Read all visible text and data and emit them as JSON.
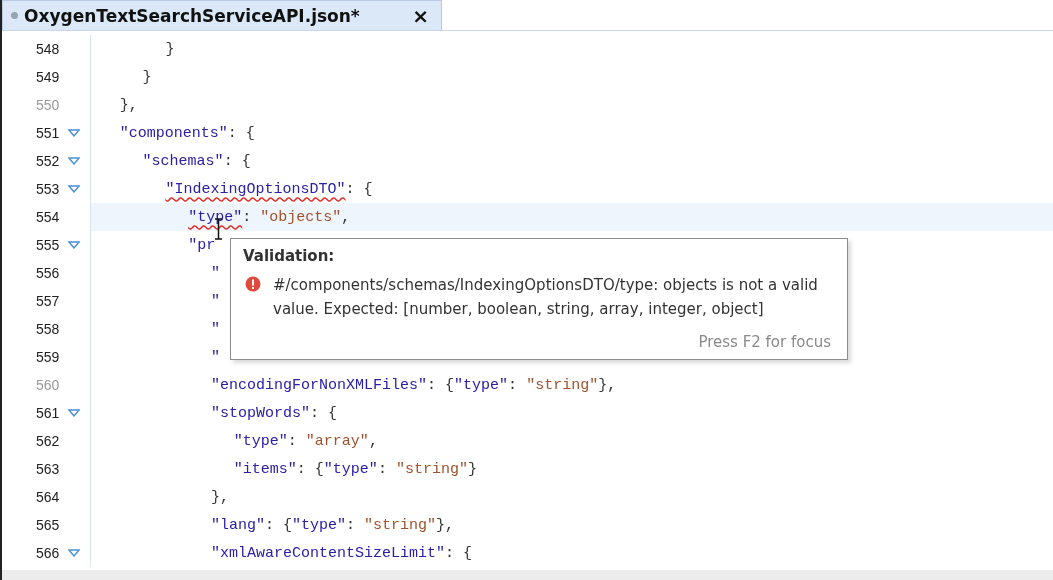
{
  "tab": {
    "title": "OxygenTextSearchServiceAPI.json*",
    "modified": true,
    "close": "×"
  },
  "lines": [
    {
      "number": "548",
      "muted": false,
      "foldable": false,
      "current": false,
      "tokens": [
        {
          "kind": "punct",
          "text": "      }",
          "error": false
        }
      ]
    },
    {
      "number": "549",
      "muted": false,
      "foldable": false,
      "current": false,
      "tokens": [
        {
          "kind": "punct",
          "text": "    }",
          "error": false
        }
      ]
    },
    {
      "number": "550",
      "muted": true,
      "foldable": false,
      "current": false,
      "tokens": [
        {
          "kind": "punct",
          "text": "  },",
          "error": false
        }
      ]
    },
    {
      "number": "551",
      "muted": false,
      "foldable": true,
      "current": false,
      "tokens": [
        {
          "kind": "key",
          "text": "  \"components\"",
          "error": false
        },
        {
          "kind": "punct",
          "text": ": {",
          "error": false
        }
      ]
    },
    {
      "number": "552",
      "muted": false,
      "foldable": true,
      "current": false,
      "tokens": [
        {
          "kind": "key",
          "text": "    \"schemas\"",
          "error": false
        },
        {
          "kind": "punct",
          "text": ": {",
          "error": false
        }
      ]
    },
    {
      "number": "553",
      "muted": false,
      "foldable": true,
      "current": false,
      "tokens": [
        {
          "kind": "key",
          "text": "      \"IndexingOptionsDTO\"",
          "error": true
        },
        {
          "kind": "punct",
          "text": ": {",
          "error": false
        }
      ]
    },
    {
      "number": "554",
      "muted": false,
      "foldable": false,
      "current": true,
      "tokens": [
        {
          "kind": "key",
          "text": "        \"type\"",
          "error": true
        },
        {
          "kind": "punct",
          "text": ": ",
          "error": false
        },
        {
          "kind": "string",
          "text": "\"objects\"",
          "error": false
        },
        {
          "kind": "punct",
          "text": ",",
          "error": false
        }
      ]
    },
    {
      "number": "555",
      "muted": false,
      "foldable": true,
      "current": false,
      "tokens": [
        {
          "kind": "key",
          "text": "        \"pr",
          "error": false
        }
      ]
    },
    {
      "number": "556",
      "muted": false,
      "foldable": false,
      "current": false,
      "tokens": [
        {
          "kind": "key",
          "text": "          \"",
          "error": false
        }
      ]
    },
    {
      "number": "557",
      "muted": false,
      "foldable": false,
      "current": false,
      "tokens": [
        {
          "kind": "key",
          "text": "          \"",
          "error": false
        }
      ]
    },
    {
      "number": "558",
      "muted": false,
      "foldable": false,
      "current": false,
      "tokens": [
        {
          "kind": "key",
          "text": "          \"",
          "error": false
        }
      ]
    },
    {
      "number": "559",
      "muted": false,
      "foldable": false,
      "current": false,
      "tokens": [
        {
          "kind": "key",
          "text": "          \"",
          "error": false
        }
      ]
    },
    {
      "number": "560",
      "muted": true,
      "foldable": false,
      "current": false,
      "tokens": [
        {
          "kind": "key",
          "text": "          \"encodingForNonXMLFiles\"",
          "error": false
        },
        {
          "kind": "punct",
          "text": ": {",
          "error": false
        },
        {
          "kind": "key",
          "text": "\"type\"",
          "error": false
        },
        {
          "kind": "punct",
          "text": ": ",
          "error": false
        },
        {
          "kind": "string",
          "text": "\"string\"",
          "error": false
        },
        {
          "kind": "punct",
          "text": "},",
          "error": false
        }
      ]
    },
    {
      "number": "561",
      "muted": false,
      "foldable": true,
      "current": false,
      "tokens": [
        {
          "kind": "key",
          "text": "          \"stopWords\"",
          "error": false
        },
        {
          "kind": "punct",
          "text": ": {",
          "error": false
        }
      ]
    },
    {
      "number": "562",
      "muted": false,
      "foldable": false,
      "current": false,
      "tokens": [
        {
          "kind": "key",
          "text": "            \"type\"",
          "error": false
        },
        {
          "kind": "punct",
          "text": ": ",
          "error": false
        },
        {
          "kind": "string",
          "text": "\"array\"",
          "error": false
        },
        {
          "kind": "punct",
          "text": ",",
          "error": false
        }
      ]
    },
    {
      "number": "563",
      "muted": false,
      "foldable": false,
      "current": false,
      "tokens": [
        {
          "kind": "key",
          "text": "            \"items\"",
          "error": false
        },
        {
          "kind": "punct",
          "text": ": {",
          "error": false
        },
        {
          "kind": "key",
          "text": "\"type\"",
          "error": false
        },
        {
          "kind": "punct",
          "text": ": ",
          "error": false
        },
        {
          "kind": "string",
          "text": "\"string\"",
          "error": false
        },
        {
          "kind": "punct",
          "text": "}",
          "error": false
        }
      ]
    },
    {
      "number": "564",
      "muted": false,
      "foldable": false,
      "current": false,
      "tokens": [
        {
          "kind": "punct",
          "text": "          },",
          "error": false
        }
      ]
    },
    {
      "number": "565",
      "muted": false,
      "foldable": false,
      "current": false,
      "tokens": [
        {
          "kind": "key",
          "text": "          \"lang\"",
          "error": false
        },
        {
          "kind": "punct",
          "text": ": {",
          "error": false
        },
        {
          "kind": "key",
          "text": "\"type\"",
          "error": false
        },
        {
          "kind": "punct",
          "text": ": ",
          "error": false
        },
        {
          "kind": "string",
          "text": "\"string\"",
          "error": false
        },
        {
          "kind": "punct",
          "text": "},",
          "error": false
        }
      ]
    },
    {
      "number": "566",
      "muted": false,
      "foldable": true,
      "current": false,
      "tokens": [
        {
          "kind": "key",
          "text": "          \"xmlAwareContentSizeLimit\"",
          "error": false
        },
        {
          "kind": "punct",
          "text": ": {",
          "error": false
        }
      ]
    }
  ],
  "tooltip": {
    "title": "Validation:",
    "message": "#/components/schemas/IndexingOptionsDTO/type: objects is not a valid value. Expected: [number, boolean, string, array, integer, object]",
    "hint": "Press F2 for focus"
  }
}
